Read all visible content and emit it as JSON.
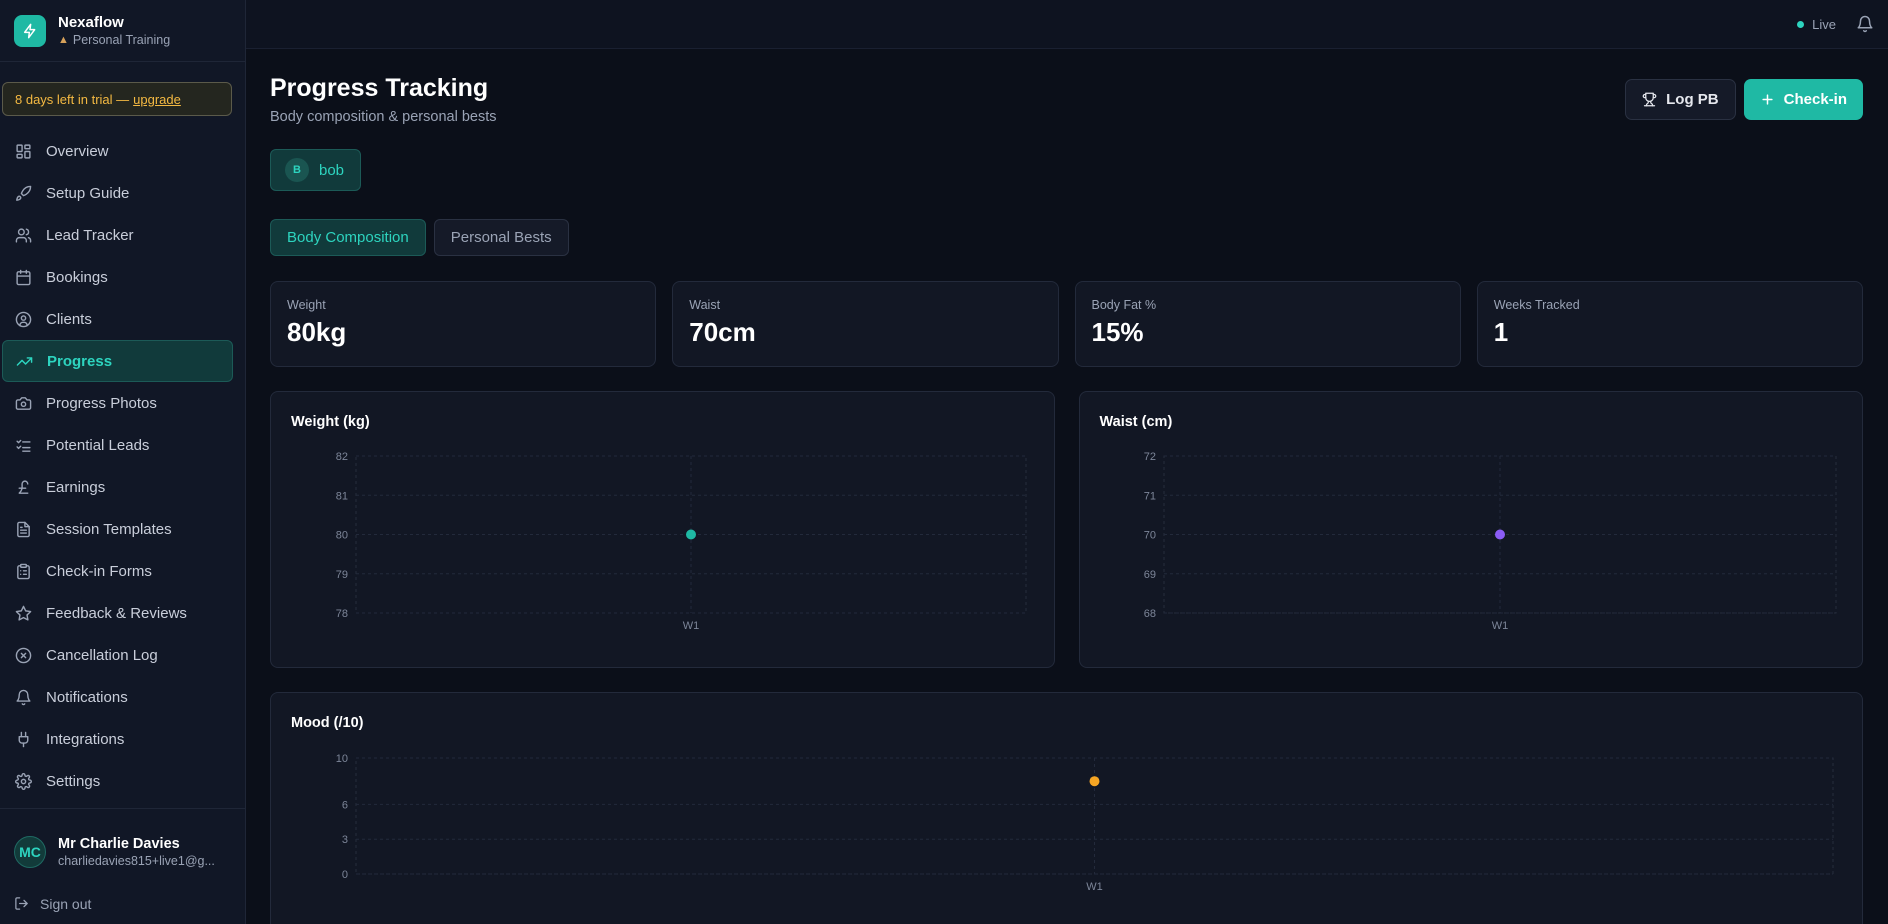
{
  "brand": {
    "name": "Nexaflow",
    "subtitle": "Personal Training"
  },
  "trial": {
    "text": "8 days left in trial —",
    "link": "upgrade"
  },
  "sidebar": {
    "items": [
      {
        "label": "Overview",
        "icon": "grid-icon"
      },
      {
        "label": "Setup Guide",
        "icon": "rocket-icon"
      },
      {
        "label": "Lead Tracker",
        "icon": "users-icon"
      },
      {
        "label": "Bookings",
        "icon": "calendar-icon"
      },
      {
        "label": "Clients",
        "icon": "user-circle-icon"
      },
      {
        "label": "Progress",
        "icon": "trending-up-icon",
        "active": true
      },
      {
        "label": "Progress Photos",
        "icon": "camera-icon"
      },
      {
        "label": "Potential Leads",
        "icon": "list-check-icon"
      },
      {
        "label": "Earnings",
        "icon": "pound-icon"
      },
      {
        "label": "Session Templates",
        "icon": "file-text-icon"
      },
      {
        "label": "Check-in Forms",
        "icon": "clipboard-icon"
      },
      {
        "label": "Feedback & Reviews",
        "icon": "star-icon"
      },
      {
        "label": "Cancellation Log",
        "icon": "x-circle-icon"
      },
      {
        "label": "Notifications",
        "icon": "bell-icon"
      },
      {
        "label": "Integrations",
        "icon": "plug-icon"
      },
      {
        "label": "Settings",
        "icon": "gear-icon"
      }
    ]
  },
  "user": {
    "initials": "MC",
    "name": "Mr Charlie Davies",
    "email": "charliedavies815+live1@g..."
  },
  "signout": "Sign out",
  "topbar": {
    "status": "Live"
  },
  "page": {
    "title": "Progress Tracking",
    "subtitle": "Body composition & personal bests",
    "log_pb": "Log PB",
    "checkin": "Check-in"
  },
  "client": {
    "initial": "B",
    "name": "bob"
  },
  "tabs": [
    {
      "label": "Body Composition",
      "active": true
    },
    {
      "label": "Personal Bests",
      "active": false
    }
  ],
  "stats": [
    {
      "label": "Weight",
      "value": "80kg"
    },
    {
      "label": "Waist",
      "value": "70cm"
    },
    {
      "label": "Body Fat %",
      "value": "15%"
    },
    {
      "label": "Weeks Tracked",
      "value": "1"
    }
  ],
  "colors": {
    "accent": "#1fb9a4",
    "weight": "#1fb9a4",
    "waist": "#8b5cf6",
    "mood": "#f5a524"
  },
  "chart_data": [
    {
      "type": "scatter",
      "title": "Weight (kg)",
      "yticks": [
        82,
        81,
        80,
        79,
        78
      ],
      "ylim": [
        78,
        82
      ],
      "x": [
        "W1"
      ],
      "series": [
        {
          "values": [
            80
          ],
          "color": "#1fb9a4"
        }
      ],
      "grid": true
    },
    {
      "type": "scatter",
      "title": "Waist (cm)",
      "yticks": [
        72,
        71,
        70,
        69,
        68
      ],
      "ylim": [
        68,
        72
      ],
      "x": [
        "W1"
      ],
      "series": [
        {
          "values": [
            70
          ],
          "color": "#8b5cf6"
        }
      ],
      "grid": true
    },
    {
      "type": "scatter",
      "title": "Mood (/10)",
      "yticks": [
        10,
        6,
        3,
        0
      ],
      "ylim": [
        0,
        10
      ],
      "x": [
        "W1"
      ],
      "series": [
        {
          "values": [
            8
          ],
          "color": "#f5a524"
        }
      ],
      "grid": true
    }
  ]
}
